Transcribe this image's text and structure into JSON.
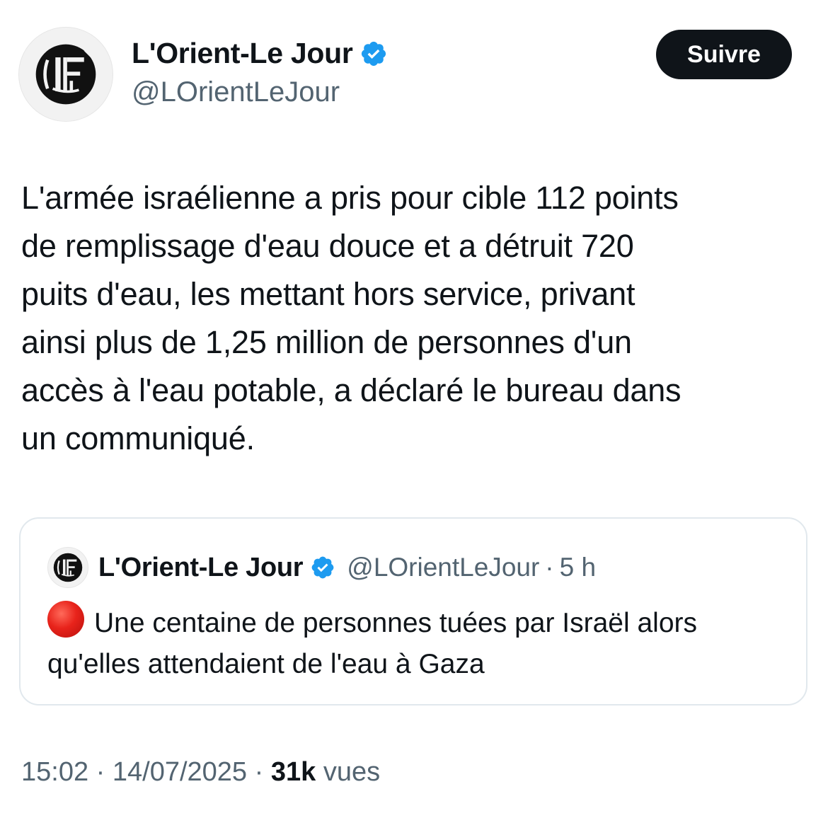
{
  "author": {
    "display_name": "L'Orient-Le Jour",
    "handle": "@LOrientLeJour",
    "avatar_icon": "lorient-le-jour-logo-icon",
    "verified_icon": "verified-badge-icon"
  },
  "follow_button": {
    "label": "Suivre"
  },
  "tweet": {
    "text": "L'armée israélienne a pris pour cible 112 points\nde remplissage d'eau douce et a détruit 720\npuits d'eau, les mettant hors service, privant\nainsi plus de 1,25 million de personnes d'un\naccès à l'eau potable, a déclaré le bureau dans\nun communiqué."
  },
  "quoted_tweet": {
    "display_name": "L'Orient-Le Jour",
    "handle": "@LOrientLeJour",
    "separator": "·",
    "time": "5 h",
    "emoji_icon": "red-circle-icon",
    "text": "Une centaine de personnes tuées par Israël alors qu'elles attendaient de l'eau à Gaza"
  },
  "meta": {
    "time": "15:02",
    "separator": "·",
    "date": "14/07/2025",
    "views_count": "31k",
    "views_label": "vues"
  },
  "colors": {
    "text_primary": "#0f1419",
    "text_secondary": "#536471",
    "verified_blue": "#1d9bf0",
    "button_bg": "#0f1419",
    "card_border": "#e1e8ed"
  }
}
